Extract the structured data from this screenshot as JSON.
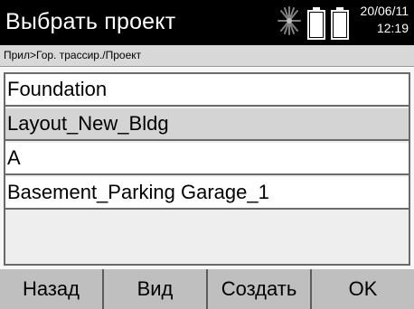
{
  "header": {
    "title": "Выбрать проект",
    "date": "20/06/11",
    "time": "12:19",
    "icons": [
      "laser-beam-icon",
      "battery-icon",
      "battery-icon"
    ]
  },
  "breadcrumb": "Прил>Гор. трассир./Проект",
  "projects": {
    "items": [
      {
        "label": "Foundation"
      },
      {
        "label": "Layout_New_Bldg",
        "selected": true
      },
      {
        "label": "A"
      },
      {
        "label": "Basement_Parking Garage_1"
      }
    ]
  },
  "softkeys": {
    "back": "Назад",
    "view": "Вид",
    "create": "Создать",
    "ok": "OK"
  },
  "colors": {
    "title_bar": "#000000",
    "selection": "#d4d4d4",
    "softkey_bar": "#bfbfbf"
  }
}
